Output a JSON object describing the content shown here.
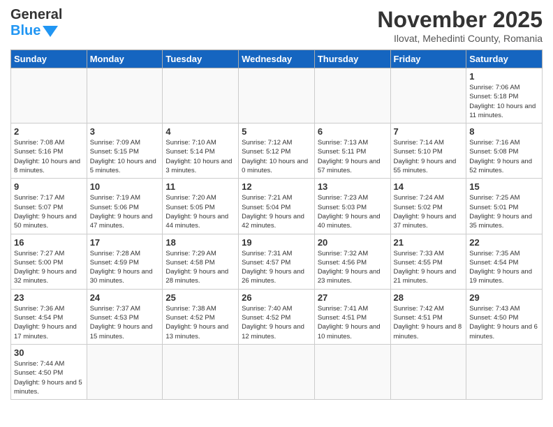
{
  "header": {
    "logo": {
      "line1": "General",
      "line2": "Blue"
    },
    "month": "November 2025",
    "location": "Ilovat, Mehedinti County, Romania"
  },
  "weekdays": [
    "Sunday",
    "Monday",
    "Tuesday",
    "Wednesday",
    "Thursday",
    "Friday",
    "Saturday"
  ],
  "weeks": [
    [
      {
        "day": "",
        "info": ""
      },
      {
        "day": "",
        "info": ""
      },
      {
        "day": "",
        "info": ""
      },
      {
        "day": "",
        "info": ""
      },
      {
        "day": "",
        "info": ""
      },
      {
        "day": "",
        "info": ""
      },
      {
        "day": "1",
        "info": "Sunrise: 7:06 AM\nSunset: 5:18 PM\nDaylight: 10 hours and 11 minutes."
      }
    ],
    [
      {
        "day": "2",
        "info": "Sunrise: 7:08 AM\nSunset: 5:16 PM\nDaylight: 10 hours and 8 minutes."
      },
      {
        "day": "3",
        "info": "Sunrise: 7:09 AM\nSunset: 5:15 PM\nDaylight: 10 hours and 5 minutes."
      },
      {
        "day": "4",
        "info": "Sunrise: 7:10 AM\nSunset: 5:14 PM\nDaylight: 10 hours and 3 minutes."
      },
      {
        "day": "5",
        "info": "Sunrise: 7:12 AM\nSunset: 5:12 PM\nDaylight: 10 hours and 0 minutes."
      },
      {
        "day": "6",
        "info": "Sunrise: 7:13 AM\nSunset: 5:11 PM\nDaylight: 9 hours and 57 minutes."
      },
      {
        "day": "7",
        "info": "Sunrise: 7:14 AM\nSunset: 5:10 PM\nDaylight: 9 hours and 55 minutes."
      },
      {
        "day": "8",
        "info": "Sunrise: 7:16 AM\nSunset: 5:08 PM\nDaylight: 9 hours and 52 minutes."
      }
    ],
    [
      {
        "day": "9",
        "info": "Sunrise: 7:17 AM\nSunset: 5:07 PM\nDaylight: 9 hours and 50 minutes."
      },
      {
        "day": "10",
        "info": "Sunrise: 7:19 AM\nSunset: 5:06 PM\nDaylight: 9 hours and 47 minutes."
      },
      {
        "day": "11",
        "info": "Sunrise: 7:20 AM\nSunset: 5:05 PM\nDaylight: 9 hours and 44 minutes."
      },
      {
        "day": "12",
        "info": "Sunrise: 7:21 AM\nSunset: 5:04 PM\nDaylight: 9 hours and 42 minutes."
      },
      {
        "day": "13",
        "info": "Sunrise: 7:23 AM\nSunset: 5:03 PM\nDaylight: 9 hours and 40 minutes."
      },
      {
        "day": "14",
        "info": "Sunrise: 7:24 AM\nSunset: 5:02 PM\nDaylight: 9 hours and 37 minutes."
      },
      {
        "day": "15",
        "info": "Sunrise: 7:25 AM\nSunset: 5:01 PM\nDaylight: 9 hours and 35 minutes."
      }
    ],
    [
      {
        "day": "16",
        "info": "Sunrise: 7:27 AM\nSunset: 5:00 PM\nDaylight: 9 hours and 32 minutes."
      },
      {
        "day": "17",
        "info": "Sunrise: 7:28 AM\nSunset: 4:59 PM\nDaylight: 9 hours and 30 minutes."
      },
      {
        "day": "18",
        "info": "Sunrise: 7:29 AM\nSunset: 4:58 PM\nDaylight: 9 hours and 28 minutes."
      },
      {
        "day": "19",
        "info": "Sunrise: 7:31 AM\nSunset: 4:57 PM\nDaylight: 9 hours and 26 minutes."
      },
      {
        "day": "20",
        "info": "Sunrise: 7:32 AM\nSunset: 4:56 PM\nDaylight: 9 hours and 23 minutes."
      },
      {
        "day": "21",
        "info": "Sunrise: 7:33 AM\nSunset: 4:55 PM\nDaylight: 9 hours and 21 minutes."
      },
      {
        "day": "22",
        "info": "Sunrise: 7:35 AM\nSunset: 4:54 PM\nDaylight: 9 hours and 19 minutes."
      }
    ],
    [
      {
        "day": "23",
        "info": "Sunrise: 7:36 AM\nSunset: 4:54 PM\nDaylight: 9 hours and 17 minutes."
      },
      {
        "day": "24",
        "info": "Sunrise: 7:37 AM\nSunset: 4:53 PM\nDaylight: 9 hours and 15 minutes."
      },
      {
        "day": "25",
        "info": "Sunrise: 7:38 AM\nSunset: 4:52 PM\nDaylight: 9 hours and 13 minutes."
      },
      {
        "day": "26",
        "info": "Sunrise: 7:40 AM\nSunset: 4:52 PM\nDaylight: 9 hours and 12 minutes."
      },
      {
        "day": "27",
        "info": "Sunrise: 7:41 AM\nSunset: 4:51 PM\nDaylight: 9 hours and 10 minutes."
      },
      {
        "day": "28",
        "info": "Sunrise: 7:42 AM\nSunset: 4:51 PM\nDaylight: 9 hours and 8 minutes."
      },
      {
        "day": "29",
        "info": "Sunrise: 7:43 AM\nSunset: 4:50 PM\nDaylight: 9 hours and 6 minutes."
      }
    ],
    [
      {
        "day": "30",
        "info": "Sunrise: 7:44 AM\nSunset: 4:50 PM\nDaylight: 9 hours and 5 minutes."
      },
      {
        "day": "",
        "info": ""
      },
      {
        "day": "",
        "info": ""
      },
      {
        "day": "",
        "info": ""
      },
      {
        "day": "",
        "info": ""
      },
      {
        "day": "",
        "info": ""
      },
      {
        "day": "",
        "info": ""
      }
    ]
  ]
}
